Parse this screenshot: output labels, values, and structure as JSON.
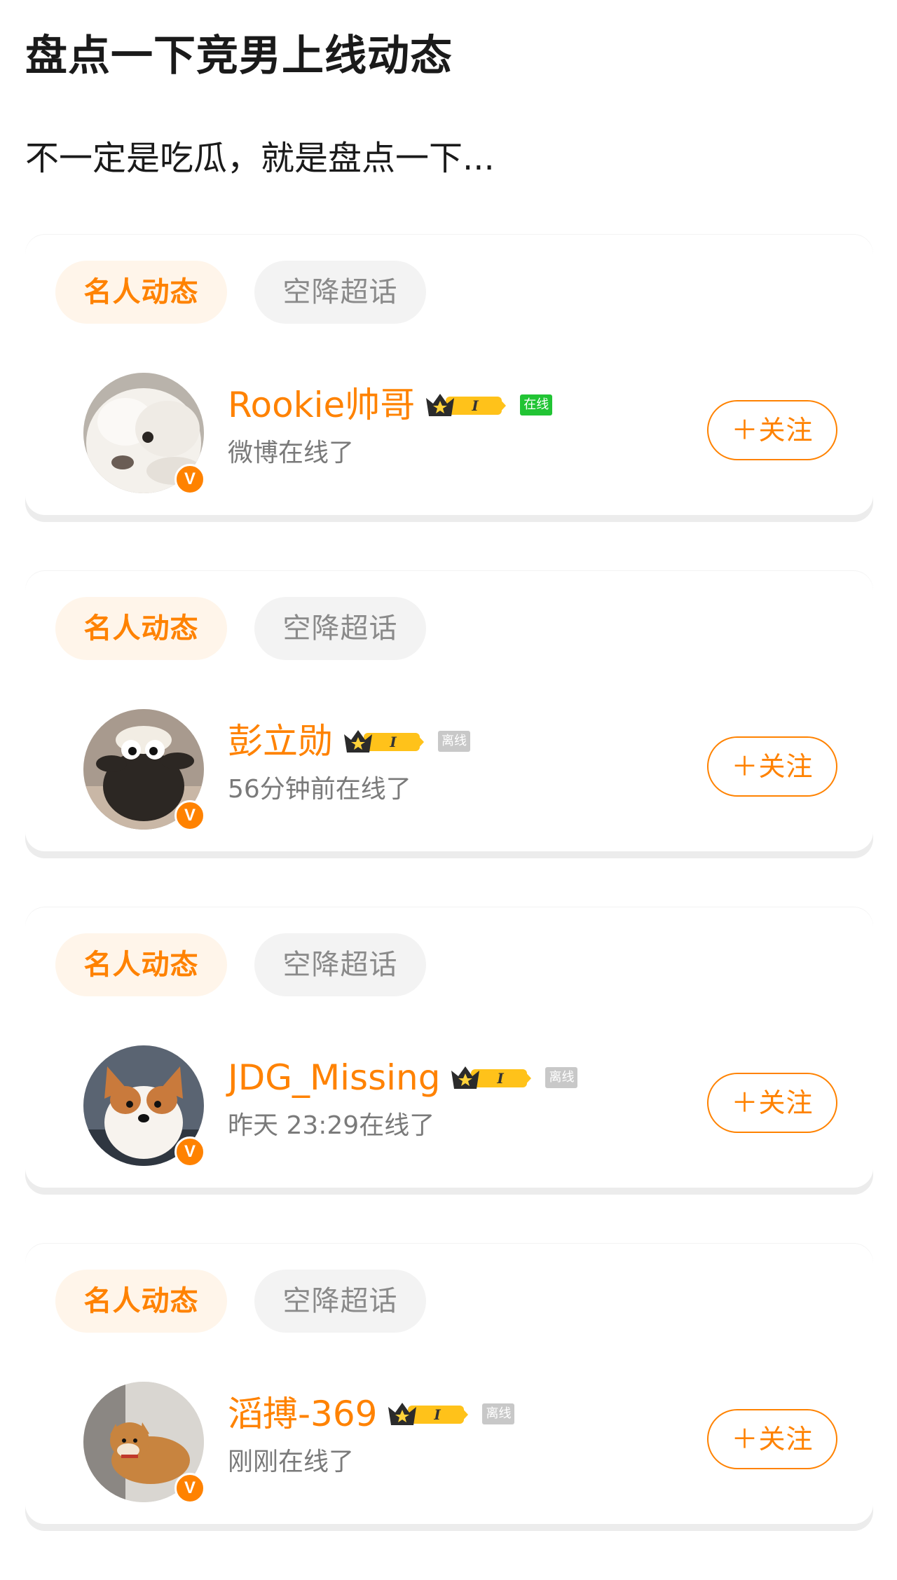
{
  "page": {
    "title": "盘点一下竞男上线动态",
    "subtitle": "不一定是吃瓜，就是盘点一下..."
  },
  "colors": {
    "accent": "#ff8200",
    "online_tag": "#21c434",
    "offline_tag": "#c8c8c8"
  },
  "cards": [
    {
      "tags": [
        "名人动态",
        "空降超话"
      ],
      "user_name": "Rookie帅哥",
      "status_tag": "在线",
      "status": "online",
      "last_online": "微博在线了",
      "follow_label": "＋关注",
      "level": "I",
      "verified_label": "V",
      "avatar_icon": "white-dog-avatar-icon"
    },
    {
      "tags": [
        "名人动态",
        "空降超话"
      ],
      "user_name": "彭立勋",
      "status_tag": "离线",
      "status": "offline",
      "last_online": "56分钟前在线了",
      "follow_label": "＋关注",
      "level": "I",
      "verified_label": "V",
      "avatar_icon": "black-sheep-toy-avatar-icon"
    },
    {
      "tags": [
        "名人动态",
        "空降超话"
      ],
      "user_name": "JDG_Missing",
      "status_tag": "离线",
      "status": "offline",
      "last_online": "昨天 23:29在线了",
      "follow_label": "＋关注",
      "level": "I",
      "verified_label": "V",
      "avatar_icon": "corgi-avatar-icon"
    },
    {
      "tags": [
        "名人动态",
        "空降超话"
      ],
      "user_name": "滔搏-369",
      "status_tag": "离线",
      "status": "offline",
      "last_online": "刚刚在线了",
      "follow_label": "＋关注",
      "level": "I",
      "verified_label": "V",
      "avatar_icon": "shiba-dog-avatar-icon"
    }
  ]
}
